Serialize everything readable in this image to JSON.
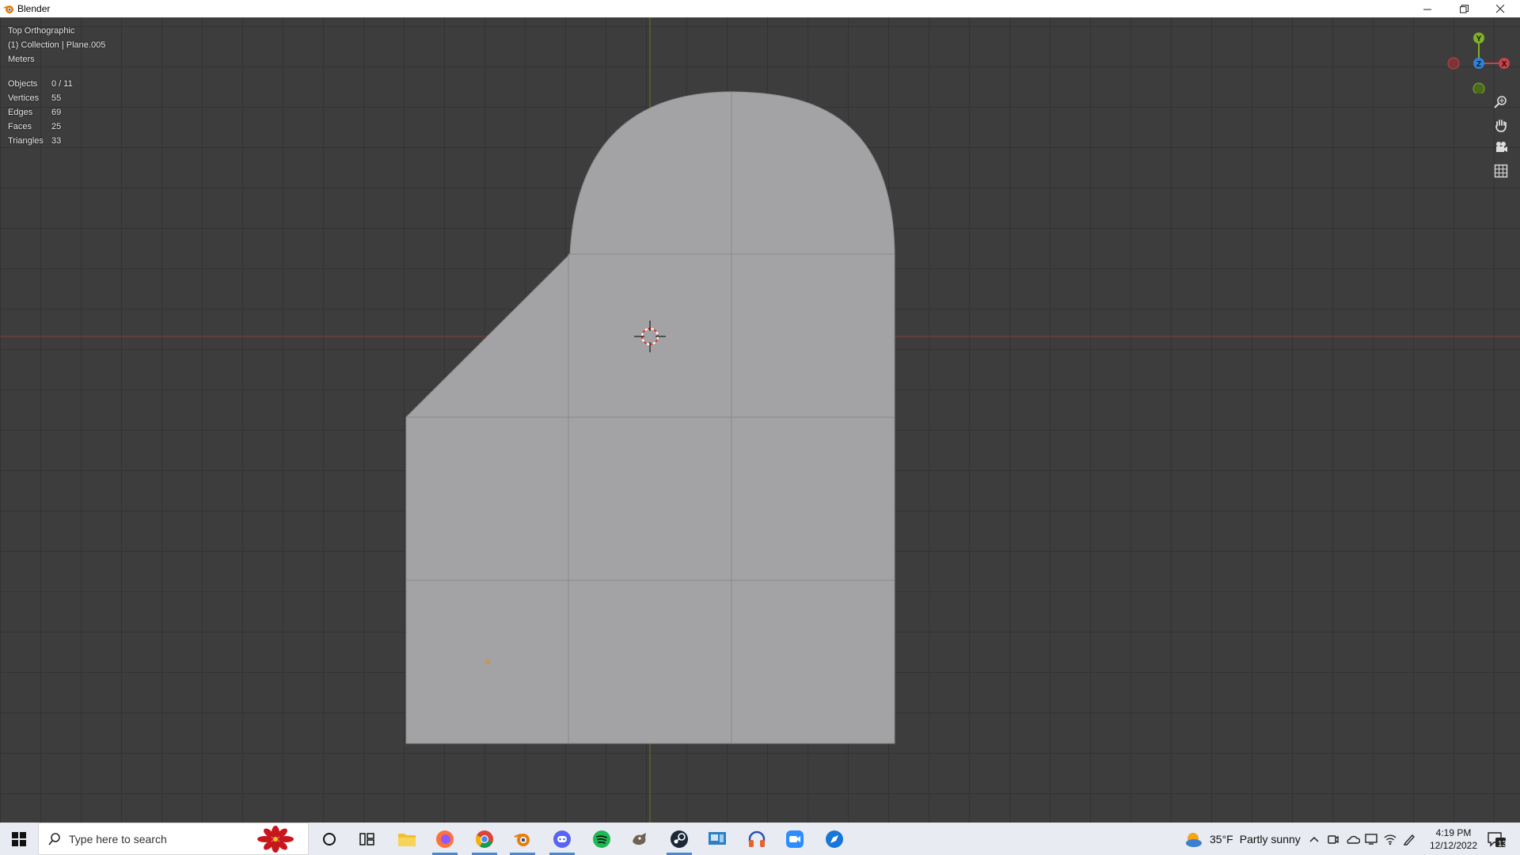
{
  "window": {
    "title": "Blender"
  },
  "viewport": {
    "view_name": "Top Orthographic",
    "collection_info": "(1) Collection | Plane.005",
    "units": "Meters",
    "stats": [
      {
        "label": "Objects",
        "value": "0 / 11"
      },
      {
        "label": "Vertices",
        "value": "55"
      },
      {
        "label": "Edges",
        "value": "69"
      },
      {
        "label": "Faces",
        "value": "25"
      },
      {
        "label": "Triangles",
        "value": "33"
      }
    ],
    "gizmo": {
      "y_label": "Y",
      "z_label": "Z",
      "x_label": "X"
    },
    "colors": {
      "x_axis": "#c8414b",
      "y_axis": "#7fb222",
      "z_axis": "#2f82d9",
      "mesh": "#a3a3a5",
      "grid_bg": "#3d3d3d"
    }
  },
  "taskbar": {
    "search_placeholder": "Type here to search",
    "apps": [
      "cortana",
      "task-view",
      "file-explorer",
      "firefox",
      "chrome",
      "blender",
      "discord",
      "spotify",
      "gimp",
      "steam",
      "remote-desktop",
      "headphones-app",
      "zoom",
      "blue-app"
    ],
    "weather": {
      "temp": "35°F",
      "condition": "Partly sunny"
    },
    "clock": {
      "time": "4:19 PM",
      "date": "12/12/2022"
    },
    "notifications": "13"
  }
}
